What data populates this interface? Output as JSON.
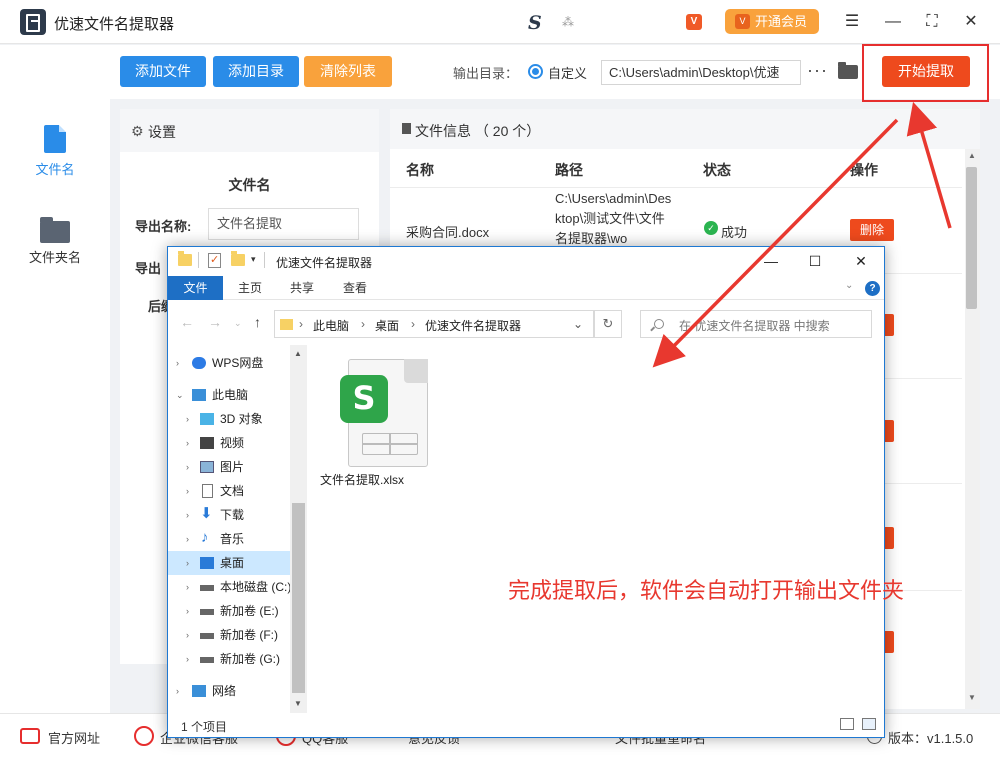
{
  "app": {
    "title": "优速文件名提取器",
    "vip_label": "开通会员",
    "vip_small": "V",
    "vip_mini": "V"
  },
  "nav": {
    "file_name": "文件名",
    "folder_name": "文件夹名"
  },
  "toolbar": {
    "add_file": "添加文件",
    "add_dir": "添加目录",
    "clear_list": "清除列表",
    "output_label": "输出目录：",
    "custom_label": "自定义",
    "output_path": "C:\\Users\\admin\\Desktop\\优速",
    "more": "···",
    "start": "开始提取"
  },
  "settings": {
    "header": "设置",
    "subtitle": "文件名",
    "export_name_label": "导出名称:",
    "export_name_value": "文件名提取",
    "label2": "导出",
    "label3": "后缀"
  },
  "fileinfo": {
    "header": "文件信息 （ 20 个）",
    "col_name": "名称",
    "col_path": "路径",
    "col_status": "状态",
    "col_action": "操作",
    "row": {
      "name": "采购合同.docx",
      "path": "C:\\Users\\admin\\Desktop\\测试文件\\文件名提取器\\wo",
      "status": "成功",
      "delete": "删除"
    }
  },
  "bottom": {
    "website": "官方网址",
    "wechat": "企业微信客服",
    "qq": "QQ客服",
    "feedback": "意见反馈",
    "batch": "文件批量重命名",
    "version": "版本：v1.1.5.0"
  },
  "explorer": {
    "title": "优速文件名提取器",
    "ribbon": {
      "file": "文件",
      "home": "主页",
      "share": "共享",
      "view": "查看"
    },
    "address": [
      "此电脑",
      "桌面",
      "优速文件名提取器"
    ],
    "search_placeholder": "在 优速文件名提取器 中搜索",
    "tree": [
      {
        "label": "WPS网盘"
      },
      {
        "label": "此电脑"
      },
      {
        "label": "3D 对象"
      },
      {
        "label": "视频"
      },
      {
        "label": "图片"
      },
      {
        "label": "文档"
      },
      {
        "label": "下载"
      },
      {
        "label": "音乐"
      },
      {
        "label": "桌面"
      },
      {
        "label": "本地磁盘 (C:)"
      },
      {
        "label": "新加卷 (E:)"
      },
      {
        "label": "新加卷 (F:)"
      },
      {
        "label": "新加卷 (G:)"
      },
      {
        "label": "网络"
      }
    ],
    "file": {
      "name": "文件名提取.xlsx",
      "badge": "S"
    },
    "status": "1 个项目"
  },
  "annotation": "完成提取后，软件会自动打开输出文件夹",
  "colors": {
    "primary_blue": "#2a8ce8",
    "orange": "#f9a23c",
    "red": "#ee4a1d",
    "annotation_red": "#e8382f"
  }
}
